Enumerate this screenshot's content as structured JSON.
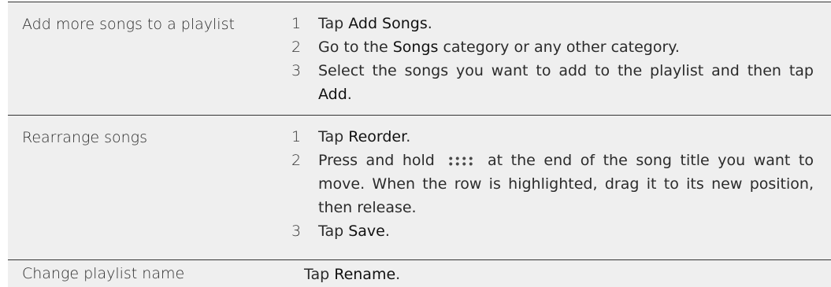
{
  "rows": [
    {
      "label": "Add more songs to a playlist",
      "steps": [
        {
          "num": "1",
          "parts": [
            "Tap ",
            "Add Songs",
            "."
          ]
        },
        {
          "num": "2",
          "parts": [
            "Go to the ",
            "Songs",
            " category or any other category."
          ]
        },
        {
          "num": "3",
          "parts": [
            "Select the songs you want to add to the playlist and then tap ",
            "Add",
            "."
          ]
        }
      ]
    },
    {
      "label": "Rearrange songs",
      "steps": [
        {
          "num": "1",
          "parts": [
            "Tap ",
            "Reorder",
            "."
          ]
        },
        {
          "num": "2",
          "before_icon": "Press and hold",
          "icon": "drag-handle-icon",
          "after_icon": "at the end of the song title you want to move. When the row is highlighted, drag it to its new position, then release."
        },
        {
          "num": "3",
          "parts": [
            "Tap ",
            "Save",
            "."
          ]
        }
      ]
    },
    {
      "label": "Change playlist name",
      "parts": [
        "Tap ",
        "Rename",
        "."
      ]
    }
  ]
}
